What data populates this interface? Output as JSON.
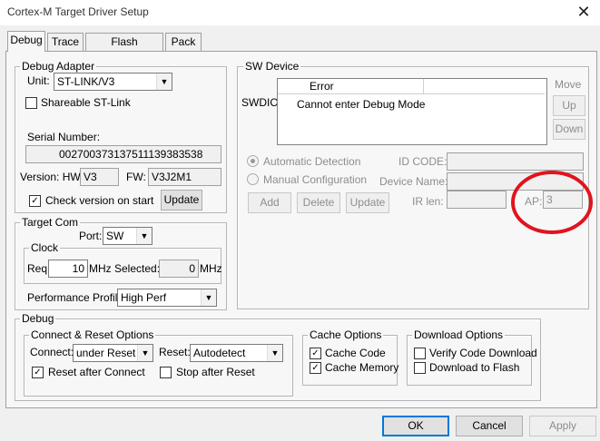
{
  "window": {
    "title": "Cortex-M Target Driver Setup",
    "close": "✕"
  },
  "tabs": [
    "Debug",
    "Trace",
    "Flash Download",
    "Pack"
  ],
  "debug_adapter": {
    "legend": "Debug Adapter",
    "unit_label": "Unit:",
    "unit_value": "ST-LINK/V3",
    "shareable_label": "Shareable ST-Link",
    "serial_label": "Serial Number:",
    "serial_value": "002700373137511139383538",
    "version_hw_label": "Version: HW:",
    "hw_value": "V3",
    "fw_label": "FW:",
    "fw_value": "V3J2M1",
    "check_version_label": "Check version on start",
    "update_button": "Update"
  },
  "sw_device": {
    "legend": "SW Device",
    "swdio_label": "SWDIO",
    "col_error": "Error",
    "error_text": "Cannot enter Debug Mode",
    "move_label": "Move",
    "up_button": "Up",
    "down_button": "Down",
    "auto_detect": "Automatic Detection",
    "manual_config": "Manual Configuration",
    "id_code_label": "ID CODE:",
    "device_name_label": "Device Name:",
    "ir_len_label": "IR len:",
    "ap_label": "AP:",
    "ap_value": "3",
    "add_button": "Add",
    "delete_button": "Delete",
    "update_button": "Update"
  },
  "target_com": {
    "legend": "Target Com",
    "port_label": "Port:",
    "port_value": "SW",
    "clock_legend": "Clock",
    "req_label": "Req:",
    "req_value": "10",
    "req_unit": "MHz",
    "selected_label": "Selected:",
    "selected_value": "0",
    "selected_unit": "MHz",
    "perf_label": "Performance Profile:",
    "perf_value": "High Perf"
  },
  "debug": {
    "legend": "Debug",
    "connect_reset_legend": "Connect & Reset Options",
    "connect_label": "Connect:",
    "connect_value": "under Reset",
    "reset_label": "Reset:",
    "reset_value": "Autodetect",
    "reset_after_connect": "Reset after Connect",
    "stop_after_reset": "Stop after Reset",
    "cache_legend": "Cache Options",
    "cache_code": "Cache Code",
    "cache_memory": "Cache Memory",
    "download_legend": "Download Options",
    "verify_code": "Verify Code Download",
    "download_flash": "Download to Flash"
  },
  "buttons": {
    "ok": "OK",
    "cancel": "Cancel",
    "apply": "Apply"
  },
  "colors": {
    "annotation_circle": "#e0141e",
    "focus": "#0078d7"
  }
}
